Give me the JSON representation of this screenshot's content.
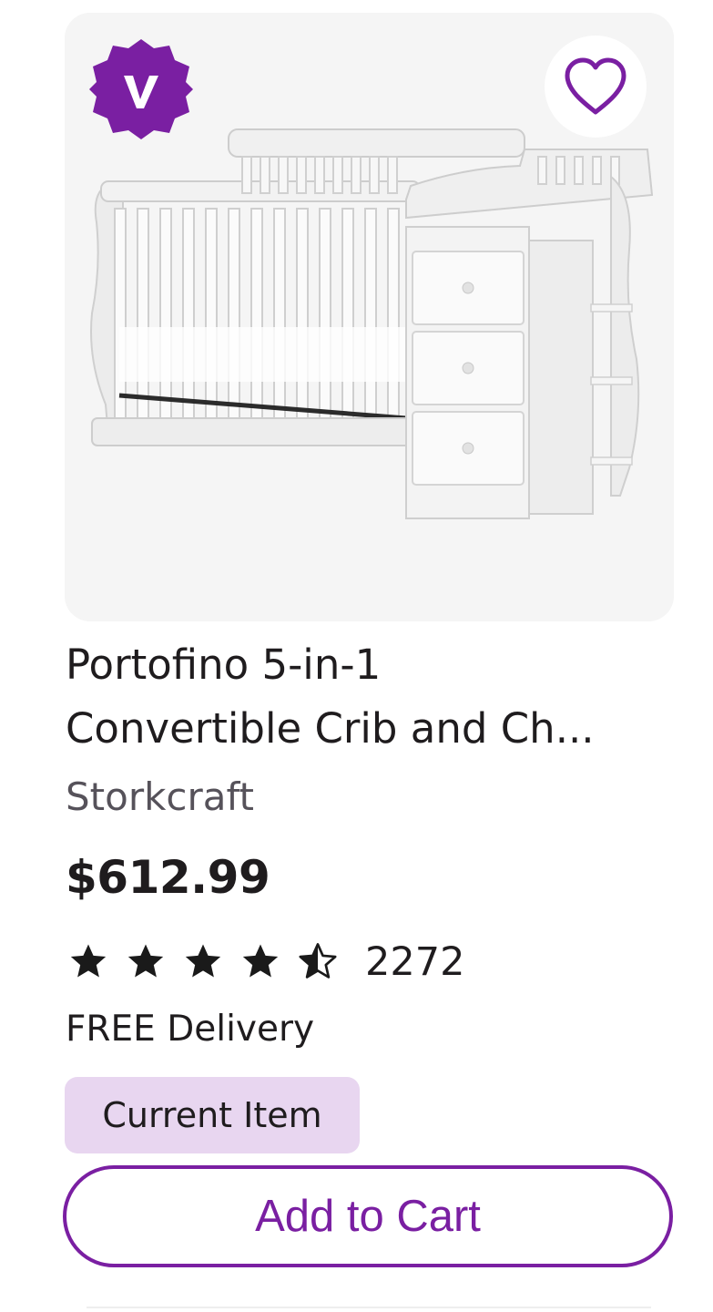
{
  "product": {
    "title": "Portofino 5-in-1 Convertible Crib and Ch...",
    "title_line1": "Portofino 5-in-1",
    "title_line2": "Convertible Crib and Ch...",
    "brand": "Storkcraft",
    "price": "$612.99",
    "rating": {
      "value": 4.5,
      "max": 5,
      "review_count": "2272"
    },
    "delivery": "FREE Delivery",
    "current_item_label": "Current Item",
    "add_to_cart_label": "Add to Cart",
    "image_icon": "white-convertible-crib-with-drawers",
    "badge_icon": "verified-check-badge",
    "favorite_icon": "heart-outline-icon"
  },
  "colors": {
    "accent": "#7a1fa2",
    "badge_bg": "#e8d6f0",
    "image_bg": "#f5f5f5"
  }
}
